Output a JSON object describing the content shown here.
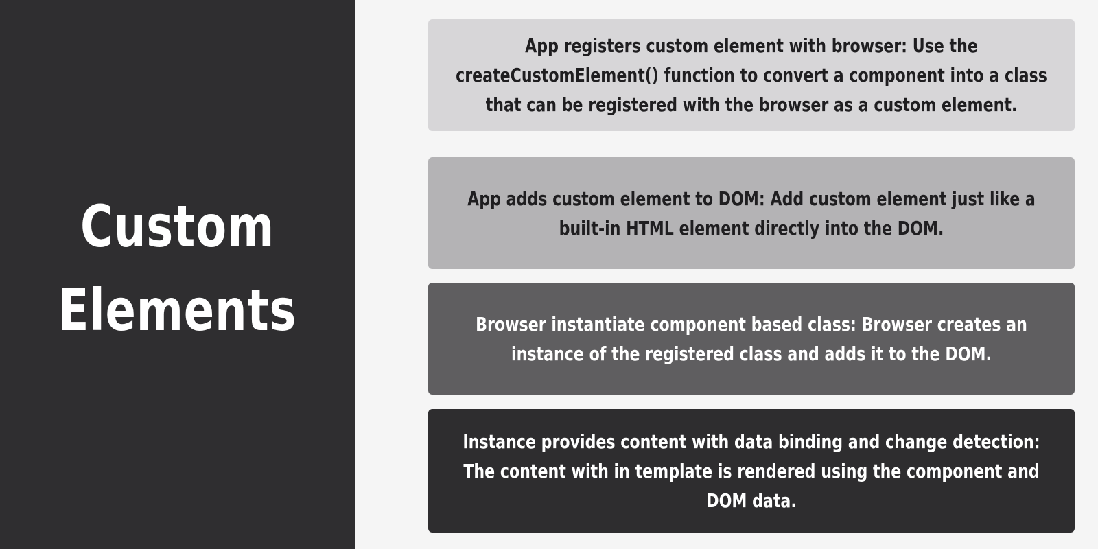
{
  "title": {
    "line1": "Custom",
    "line2": "Elements"
  },
  "steps": [
    {
      "text": "App registers custom element with browser: Use the createCustomElement() function to convert a component into a class that can be registered with the browser as a custom element."
    },
    {
      "text": "App adds custom element to DOM: Add custom element just like a built-in HTML element directly into the DOM."
    },
    {
      "text": "Browser instantiate component based class: Browser creates an instance of the registered class and adds it to the DOM."
    },
    {
      "text": "Instance provides content with data binding and change detection: The content with in template is rendered using the component and DOM data."
    }
  ],
  "colors": {
    "left_panel": "#2f2e30",
    "step1": "#d7d6d8",
    "step2": "#b4b3b5",
    "step3": "#5f5e60",
    "step4": "#2e2d2f"
  }
}
